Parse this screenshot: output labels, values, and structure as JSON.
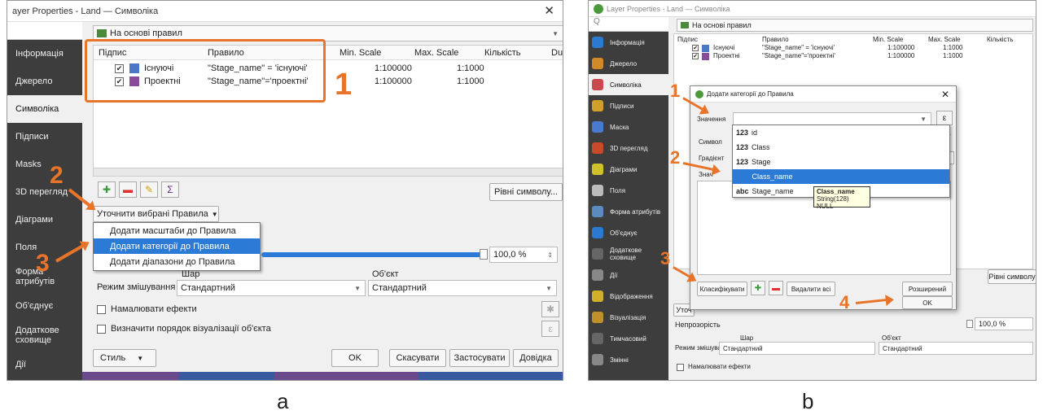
{
  "left": {
    "title": "ayer Properties - Land — Символіка",
    "renderer": "На основі правил",
    "sidebar": [
      "Інформація",
      "Джерело",
      "Символіка",
      "Підписи",
      "Masks",
      "3D перегляд",
      "Діаграми",
      "Поля",
      "Форма атрибутів",
      "Об'єднує",
      "Додаткове сховище",
      "Дії"
    ],
    "columns": [
      "Підпис",
      "Правило",
      "Min. Scale",
      "Max. Scale",
      "Кількість",
      "Du"
    ],
    "rows": [
      {
        "label": "Існуючі",
        "rule": "\"Stage_name\" = 'існуючі'",
        "min": "1:100000",
        "max": "1:1000",
        "color": "#4a78c4"
      },
      {
        "label": "Проектні",
        "rule": "\"Stage_name\"='проектні'",
        "min": "1:100000",
        "max": "1:1000",
        "color": "#8a4a9a"
      }
    ],
    "levels_btn": "Рівні символу...",
    "refine_btn": "Уточнити вибрані Правила",
    "menu": [
      "Додати масштаби до Правила",
      "Додати категорії до Правила",
      "Додати діапазони до Правила"
    ],
    "opacity": "100,0 %",
    "layer_col": "Шар",
    "object_col": "Об'єкт",
    "blend_label": "Режим змішування",
    "blend_layer": "Стандартний",
    "blend_object": "Стандартний",
    "effects": "Намалювати ефекти",
    "order": "Визначити порядок візуалізації об'єкта",
    "style_btn": "Стиль",
    "ok": "OK",
    "cancel": "Скасувати",
    "apply": "Застосувати",
    "help": "Довідка",
    "nums": [
      "1",
      "2",
      "3"
    ],
    "caption": "a"
  },
  "right": {
    "title": "Layer Properties - Land — Символіка",
    "search": "Q",
    "renderer": "На основі правил",
    "sidebar": [
      "Інформація",
      "Джерело",
      "Символіка",
      "Підписи",
      "Маска",
      "3D перегляд",
      "Діаграми",
      "Поля",
      "Форма атрибутів",
      "Об'єднує",
      "Додаткове сховище",
      "Дії",
      "Відображення",
      "Візуалізація",
      "Тимчасовий",
      "Змінні"
    ],
    "columns": [
      "Підпис",
      "Правило",
      "Min. Scale",
      "Max. Scale",
      "Кількість"
    ],
    "rows": [
      {
        "label": "Існуючі",
        "rule": "\"Stage_name\" = 'існуючі'",
        "min": "1:100000",
        "max": "1:1000"
      },
      {
        "label": "Проектні",
        "rule": "\"Stage_name\"='проектні'",
        "min": "1:100000",
        "max": "1:1000"
      }
    ],
    "dialog_title": "Додати категорії до Правила",
    "value_label": "Значення",
    "symbol_label": "Символ",
    "gradient_label": "Градієнт",
    "zna_label": "Знач",
    "fields": [
      {
        "type": "123",
        "name": "id"
      },
      {
        "type": "123",
        "name": "Class"
      },
      {
        "type": "123",
        "name": "Stage"
      },
      {
        "type": "abc",
        "name": "Class_name"
      },
      {
        "type": "abc",
        "name": "Stage_name"
      }
    ],
    "tooltip_name": "Class_name",
    "tooltip_type": "String(128) NULL",
    "classify": "Класифікувати",
    "delete_all": "Видалити всі",
    "advanced": "Розширений",
    "ok": "OK",
    "levels_btn": "Рівні символу",
    "refine_short": "Уточ",
    "opacity_label": "Непрозорість",
    "opacity": "100,0 %",
    "layer_col": "Шар",
    "object_col": "Об'єкт",
    "blend_label": "Режим змішування",
    "blend_layer": "Стандартний",
    "blend_object": "Стандартний",
    "effects": "Намалювати ефекти",
    "nums": [
      "1",
      "2",
      "3",
      "4"
    ],
    "caption": "b"
  }
}
